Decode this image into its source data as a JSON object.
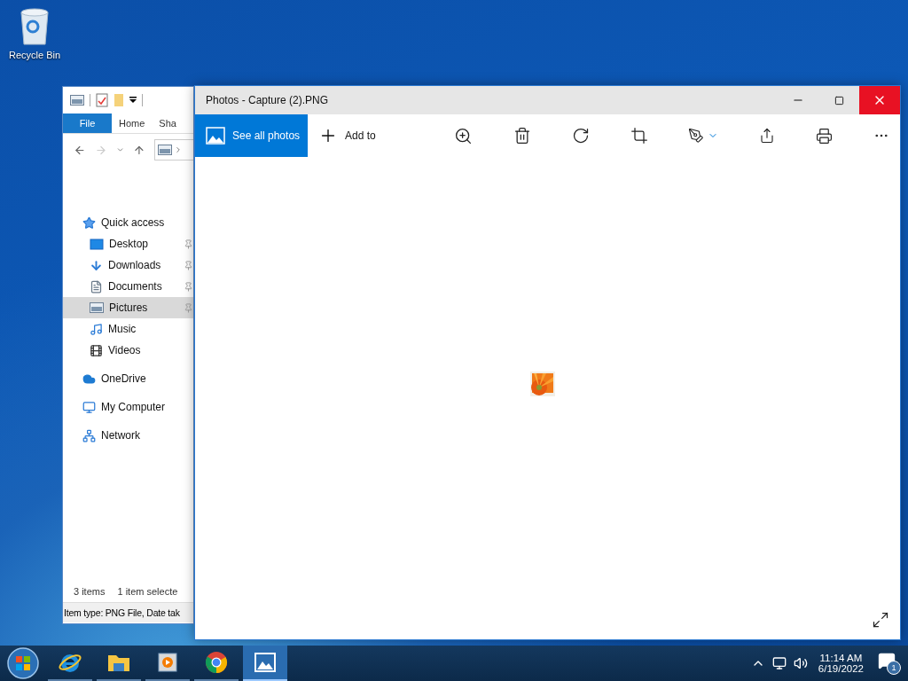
{
  "desktop": {
    "icons": [
      {
        "label": "Recycle Bin"
      }
    ]
  },
  "explorer": {
    "ribbon_tabs": [
      {
        "label": "File",
        "selected": true
      },
      {
        "label": "Home",
        "selected": false
      },
      {
        "label": "Sha",
        "selected": false
      }
    ],
    "nav_tree": [
      {
        "label": "Quick access",
        "kind": "star",
        "selected": false,
        "children": [
          {
            "label": "Desktop",
            "kind": "desktop",
            "selected": false
          },
          {
            "label": "Downloads",
            "kind": "downloads",
            "selected": false
          },
          {
            "label": "Documents",
            "kind": "documents",
            "selected": false
          },
          {
            "label": "Pictures",
            "kind": "pictures",
            "selected": true
          },
          {
            "label": "Music",
            "kind": "music",
            "selected": false
          },
          {
            "label": "Videos",
            "kind": "videos",
            "selected": false
          }
        ]
      },
      {
        "label": "OneDrive",
        "kind": "cloud",
        "selected": false
      },
      {
        "label": "My Computer",
        "kind": "computer",
        "selected": false
      },
      {
        "label": "Network",
        "kind": "network",
        "selected": false
      }
    ],
    "status_bar": {
      "items": "3 items",
      "selection": "1 item selecte"
    },
    "details_bar": "Item type: PNG File, Date tak"
  },
  "photos": {
    "title": "Photos - Capture (2).PNG",
    "see_all": "See all photos",
    "add_to": "Add to"
  },
  "taskbar": {
    "apps": [
      {
        "kind": "ie",
        "selected": false
      },
      {
        "kind": "folder",
        "selected": false
      },
      {
        "kind": "media",
        "selected": false
      },
      {
        "kind": "chrome",
        "selected": false
      },
      {
        "kind": "photos",
        "selected": true
      }
    ],
    "time": "11:14 AM",
    "date": "6/19/2022",
    "notifications": "1"
  }
}
